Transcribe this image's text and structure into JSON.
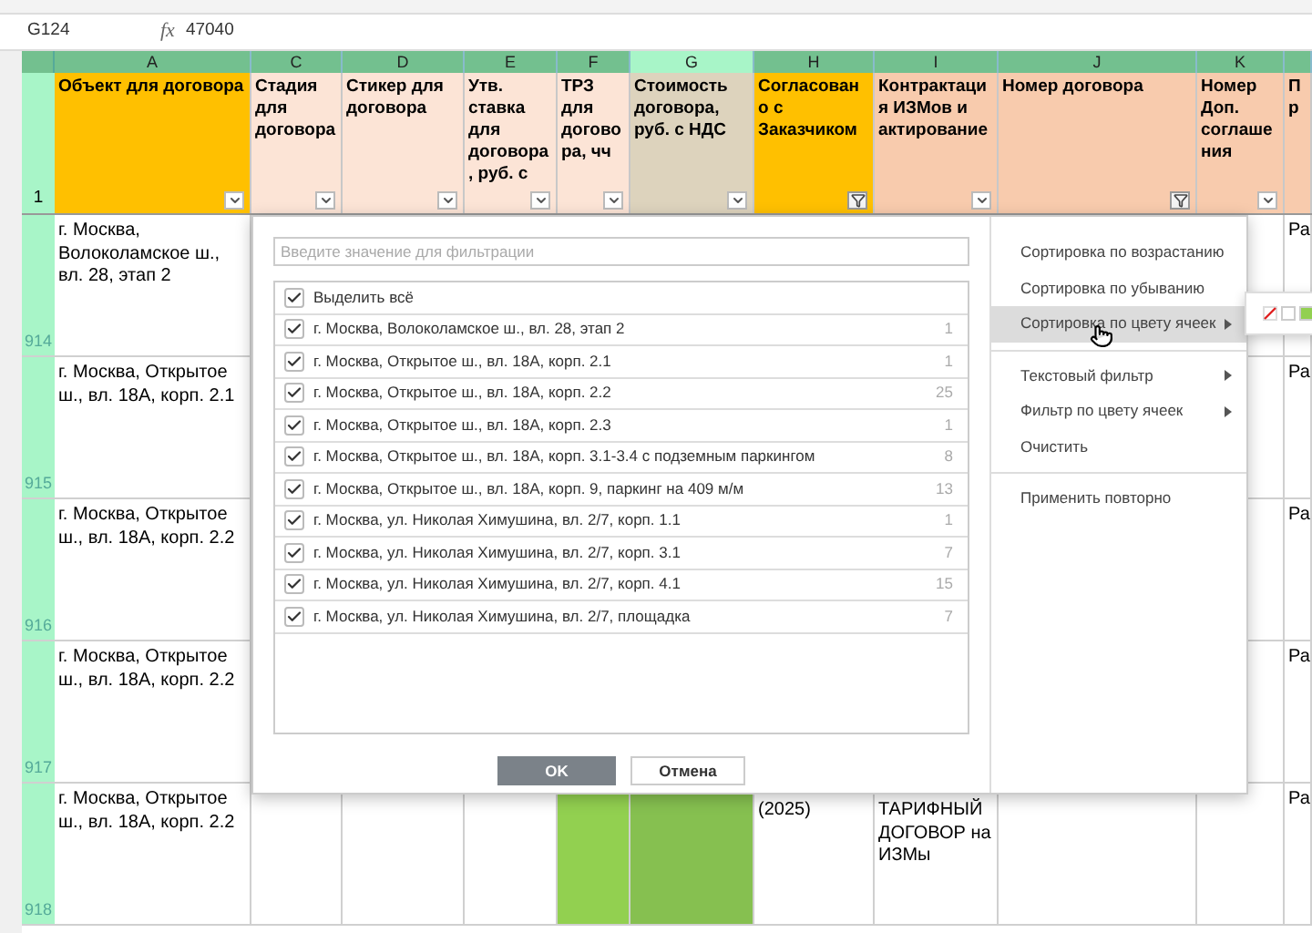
{
  "formula_bar": {
    "cell": "G124",
    "fx": "fx",
    "value": "47040"
  },
  "columns": [
    {
      "letter": "A",
      "header": "Объект для договора",
      "filtered": false,
      "selected": false
    },
    {
      "letter": "C",
      "header": "Стадия для договора",
      "filtered": false,
      "selected": false
    },
    {
      "letter": "D",
      "header": "Стикер для договора",
      "filtered": false,
      "selected": false
    },
    {
      "letter": "E",
      "header": "Утв. ставка для договора, руб. с",
      "filtered": false,
      "selected": false
    },
    {
      "letter": "F",
      "header": "ТРЗ для договора, чч",
      "filtered": false,
      "selected": false
    },
    {
      "letter": "G",
      "header": "Стоимость договора, руб. с НДС",
      "filtered": false,
      "selected": true
    },
    {
      "letter": "H",
      "header": "Согласовано с Заказчиком",
      "filtered": true,
      "selected": false
    },
    {
      "letter": "I",
      "header": "Контрактация ИЗМов и актирование",
      "filtered": false,
      "selected": false
    },
    {
      "letter": "J",
      "header": "Номер договора",
      "filtered": true,
      "selected": false
    },
    {
      "letter": "K",
      "header": "Номер Доп. соглашения",
      "filtered": false,
      "selected": false
    },
    {
      "header": "Пр",
      "selected": false
    }
  ],
  "header_row_number": "1",
  "rows": [
    {
      "number": "914",
      "address": "г. Москва, Волоколамское ш., вл. 28, этап 2",
      "col_l": "Ра"
    },
    {
      "number": "915",
      "address": "г. Москва, Открытое ш., вл. 18А, корп. 2.1",
      "col_l": "Ра"
    },
    {
      "number": "916",
      "address": "г. Москва, Открытое ш., вл. 18А, корп. 2.2",
      "col_l": "Ра"
    },
    {
      "number": "917",
      "address": "г. Москва, Открытое ш., вл. 18А, корп. 2.2",
      "col_l": "Ра"
    },
    {
      "number": "918",
      "address": "г. Москва, Открытое ш., вл. 18А, корп. 2.2",
      "col_h": "(2025)",
      "col_i": "ТАРИФНЫЙ ДОГОВОР на ИЗМы",
      "col_l": "Ра",
      "green": true
    }
  ],
  "filter": {
    "search": {
      "placeholder": "Введите значение для фильтрации"
    },
    "select_all": {
      "label": "Выделить всё",
      "checked": true
    },
    "items": [
      {
        "label": "г. Москва, Волоколамское ш., вл. 28, этап 2",
        "count": "1",
        "checked": true
      },
      {
        "label": "г. Москва, Открытое ш., вл. 18А, корп. 2.1",
        "count": "1",
        "checked": true
      },
      {
        "label": "г. Москва, Открытое ш., вл. 18А, корп. 2.2",
        "count": "25",
        "checked": true
      },
      {
        "label": "г. Москва, Открытое ш., вл. 18А, корп. 2.3",
        "count": "1",
        "checked": true
      },
      {
        "label": "г. Москва, Открытое ш., вл. 18А, корп. 3.1-3.4 с подземным паркингом",
        "count": "8",
        "checked": true
      },
      {
        "label": "г. Москва, Открытое ш., вл. 18А, корп. 9, паркинг на 409 м/м",
        "count": "13",
        "checked": true
      },
      {
        "label": "г. Москва, ул. Николая Химушина, вл. 2/7, корп. 1.1",
        "count": "1",
        "checked": true
      },
      {
        "label": "г. Москва, ул. Николая Химушина, вл. 2/7, корп. 3.1",
        "count": "7",
        "checked": true
      },
      {
        "label": "г. Москва, ул. Николая Химушина, вл. 2/7, корп. 4.1",
        "count": "15",
        "checked": true
      },
      {
        "label": "г. Москва, ул. Николая Химушина, вл. 2/7, площадка",
        "count": "7",
        "checked": true
      }
    ],
    "buttons": {
      "ok": "OK",
      "cancel": "Отмена"
    }
  },
  "menu": {
    "sections": [
      [
        {
          "label": "Сортировка по возрастанию",
          "submenu": false,
          "selected": false
        },
        {
          "label": "Сортировка по убыванию",
          "submenu": false,
          "selected": false
        },
        {
          "label": "Сортировка по цвету ячеек",
          "submenu": true,
          "selected": true
        }
      ],
      [
        {
          "label": "Текстовый фильтр",
          "submenu": true,
          "selected": false
        },
        {
          "label": "Фильтр по цвету ячеек",
          "submenu": true,
          "selected": false
        },
        {
          "label": "Очистить",
          "submenu": false,
          "selected": false
        }
      ],
      [
        {
          "label": "Применить повторно",
          "submenu": false,
          "selected": false
        }
      ]
    ],
    "swatches": [
      {
        "kind": "none"
      },
      {
        "kind": "fill",
        "color": "#ffffff"
      },
      {
        "kind": "fill",
        "color": "#92d050"
      }
    ]
  }
}
